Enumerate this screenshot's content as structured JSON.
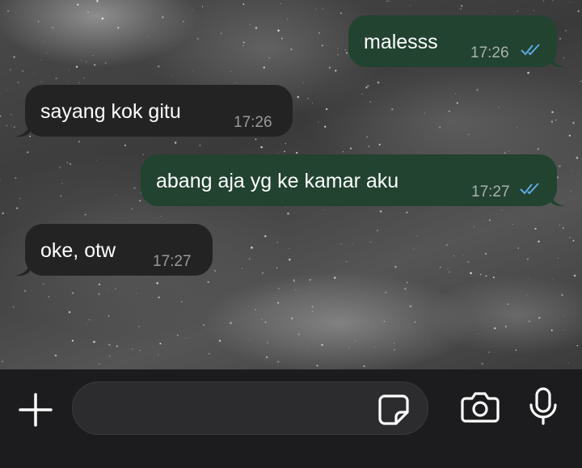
{
  "messages": [
    {
      "direction": "outgoing",
      "text": "malesss",
      "time": "17:26",
      "status_icon": "double-check-read-icon"
    },
    {
      "direction": "incoming",
      "text": "sayang kok gitu",
      "time": "17:26"
    },
    {
      "direction": "outgoing",
      "text": "abang aja yg ke kamar aku",
      "time": "17:27",
      "status_icon": "double-check-read-icon"
    },
    {
      "direction": "incoming",
      "text": "oke, otw",
      "time": "17:27"
    }
  ],
  "composer": {
    "placeholder": "",
    "icons": [
      "plus-icon",
      "sticker-icon",
      "camera-icon",
      "microphone-icon"
    ]
  },
  "colors": {
    "outgoing_bubble": "#21432f",
    "incoming_bubble": "#232323",
    "read_tick": "#5fa8e6",
    "composer_bar": "#1c1c1e"
  }
}
